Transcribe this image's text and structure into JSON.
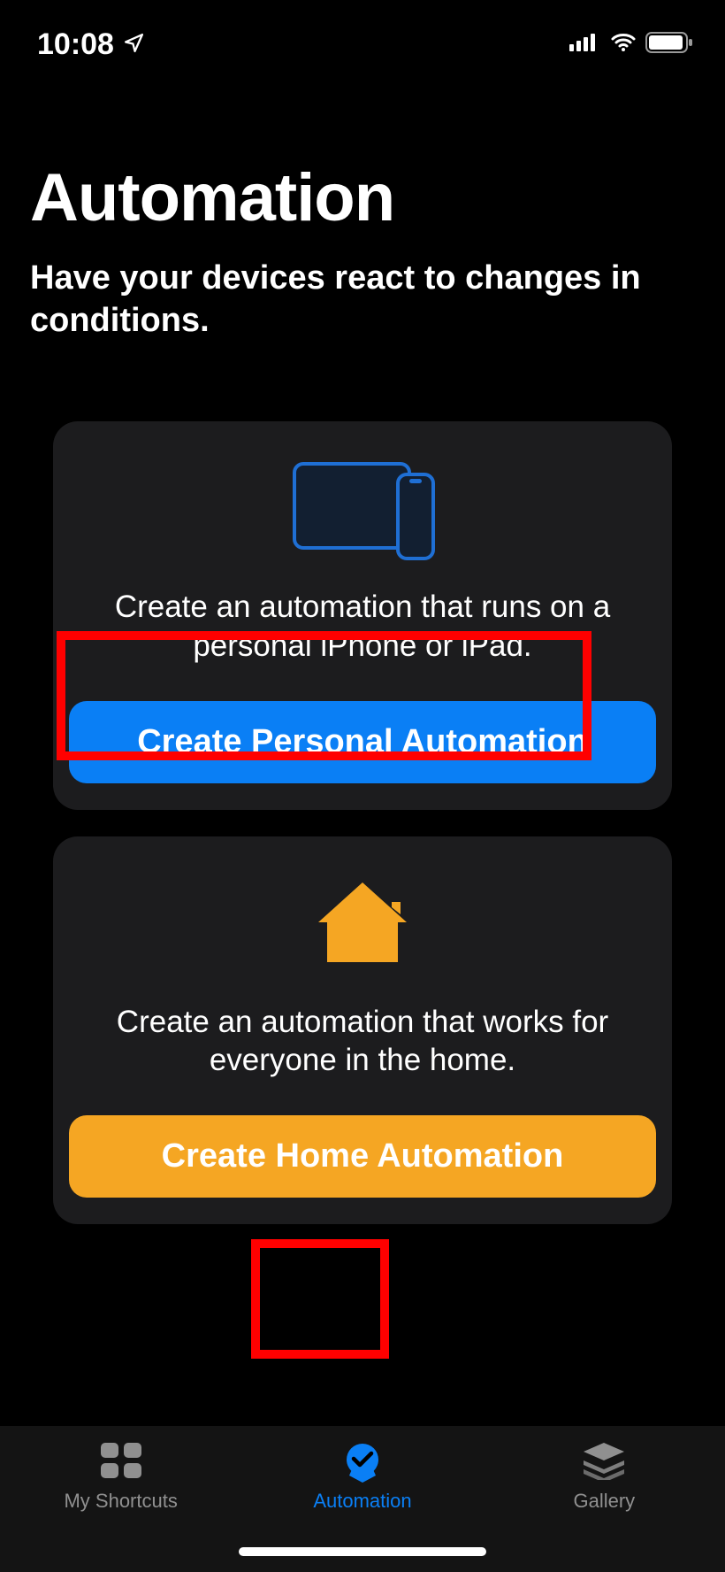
{
  "statusBar": {
    "time": "10:08"
  },
  "header": {
    "title": "Automation",
    "subtitle": "Have your devices react to changes in conditions."
  },
  "cards": {
    "personal": {
      "description": "Create an automation that runs on a personal iPhone or iPad.",
      "buttonLabel": "Create Personal Automation"
    },
    "home": {
      "description": "Create an automation that works for everyone in the home.",
      "buttonLabel": "Create Home Automation"
    }
  },
  "tabBar": {
    "myShortcuts": "My Shortcuts",
    "automation": "Automation",
    "gallery": "Gallery"
  },
  "colors": {
    "accentBlue": "#0a7ff5",
    "accentOrange": "#f5a623",
    "highlightRed": "#ff0000"
  }
}
